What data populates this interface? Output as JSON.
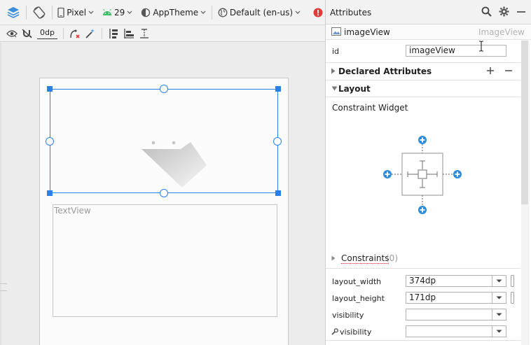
{
  "toolbar": {
    "device_label": "Pixel",
    "api_label": "29",
    "theme_label": "AppTheme",
    "locale_label": "Default (en-us)",
    "margin_label": "0dp"
  },
  "canvas": {
    "textview_placeholder": "TextView"
  },
  "panel": {
    "title": "Attributes",
    "component_name": "imageView",
    "component_type": "ImageView",
    "id_label": "id",
    "id_value": "imageView",
    "declared_title": "Declared Attributes",
    "layout_title": "Layout",
    "constraint_widget_label": "Constraint Widget",
    "constraints_label": "Constraints",
    "constraints_count": "(0)",
    "rows": [
      {
        "label": "layout_width",
        "value": "374dp"
      },
      {
        "label": "layout_height",
        "value": "171dp"
      },
      {
        "label": "visibility",
        "value": ""
      },
      {
        "label": "visibility",
        "value": ""
      }
    ]
  },
  "colors": {
    "selection": "#2b80e8",
    "accent_plus": "#2e8bd8",
    "error": "#e03c3c"
  }
}
